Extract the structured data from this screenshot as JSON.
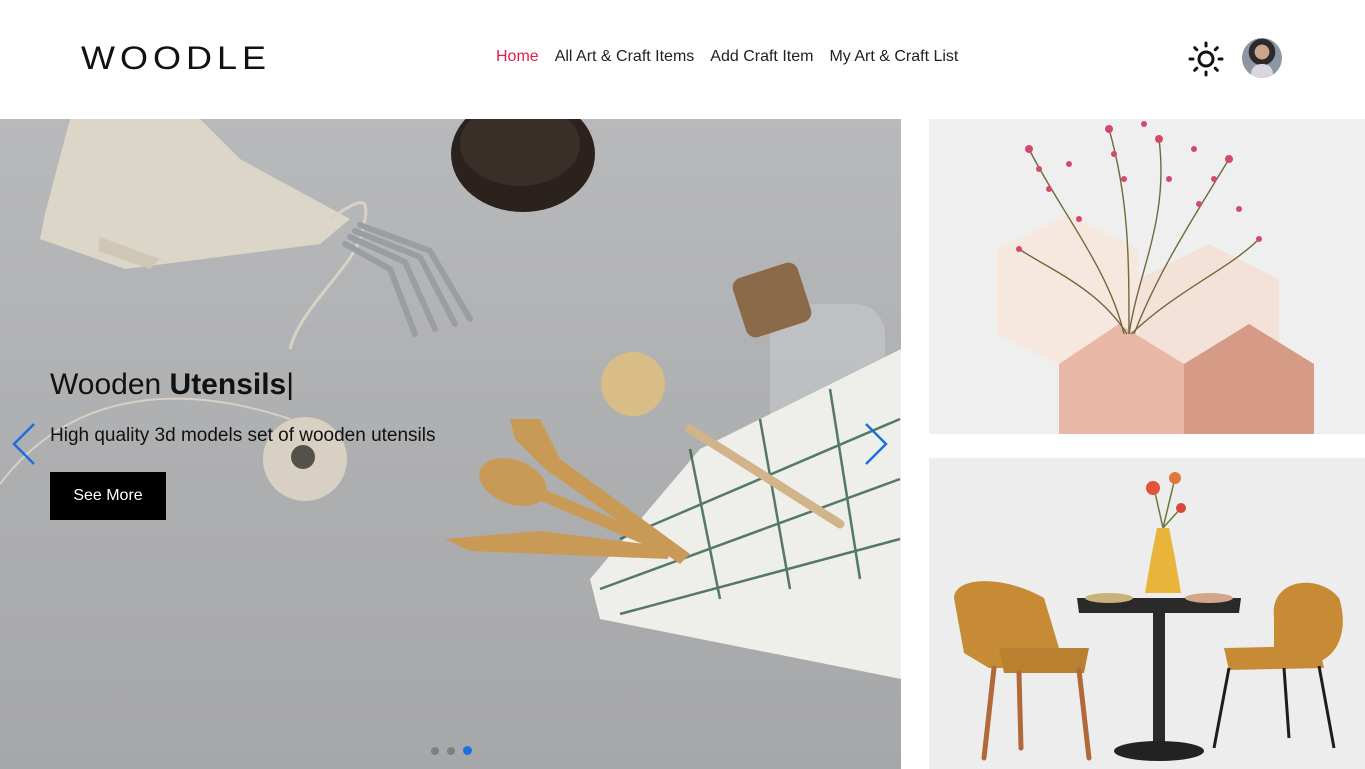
{
  "brand": {
    "logo_text": "WOODLE"
  },
  "nav": {
    "items": [
      {
        "label": "Home",
        "active": true
      },
      {
        "label": "All Art & Craft Items",
        "active": false
      },
      {
        "label": "Add Craft Item",
        "active": false
      },
      {
        "label": "My Art & Craft List",
        "active": false
      }
    ]
  },
  "header": {
    "theme_icon": "sun-icon",
    "avatar_icon": "user-avatar"
  },
  "slider": {
    "title_plain": "Wooden ",
    "title_bold": "Utensils",
    "cursor": "|",
    "subtitle": "High quality 3d models set of wooden utensils",
    "button_label": "See More",
    "prev_icon": "chevron-left-icon",
    "next_icon": "chevron-right-icon",
    "slide_count": 3,
    "active_slide": 3
  },
  "colors": {
    "nav_active": "#e11d48",
    "accent_blue": "#1d6fe0",
    "button_bg": "#000000"
  }
}
